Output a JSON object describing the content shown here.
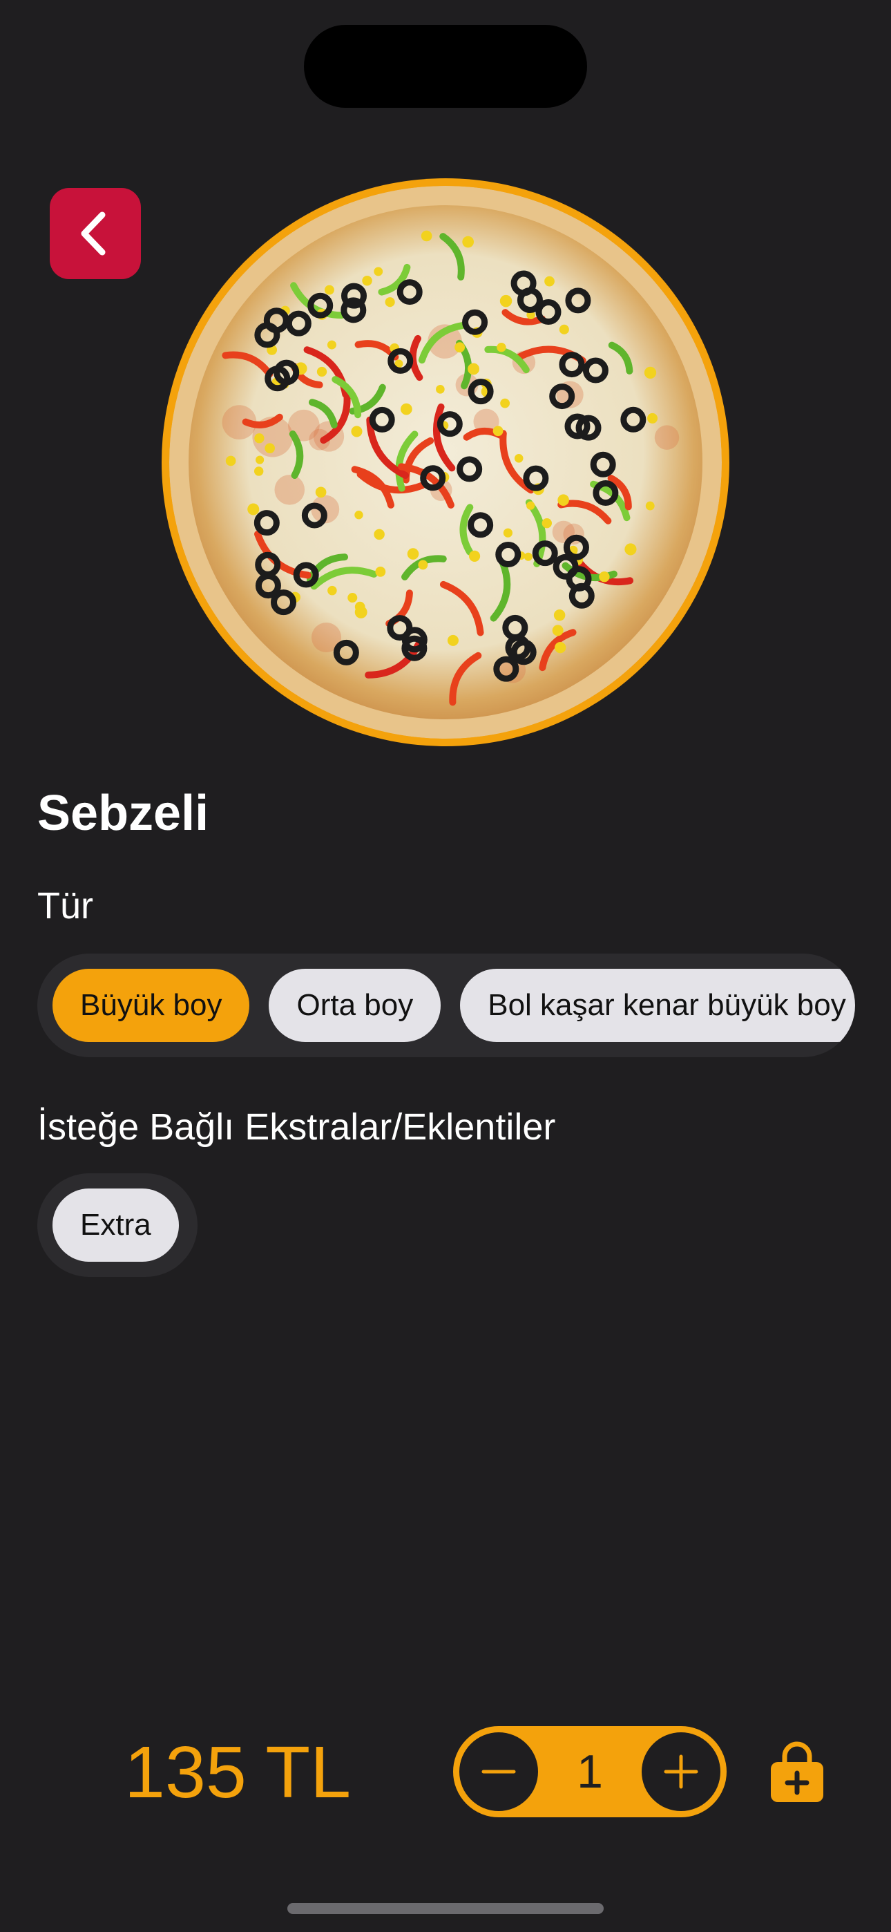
{
  "product": {
    "title": "Sebzeli",
    "image_icon": "pizza-image"
  },
  "type_section": {
    "label": "Tür",
    "options": [
      {
        "label": "Büyük boy",
        "selected": true
      },
      {
        "label": "Orta boy",
        "selected": false
      },
      {
        "label": "Bol kaşar kenar büyük boy",
        "selected": false
      }
    ]
  },
  "extras_section": {
    "label": "İsteğe Bağlı Ekstralar/Eklentiler",
    "options": [
      {
        "label": "Extra",
        "selected": false
      }
    ]
  },
  "footer": {
    "price": "135 TL",
    "quantity": "1"
  },
  "colors": {
    "accent": "#f4a20c",
    "back_button": "#c8123a",
    "background": "#1f1e20"
  }
}
